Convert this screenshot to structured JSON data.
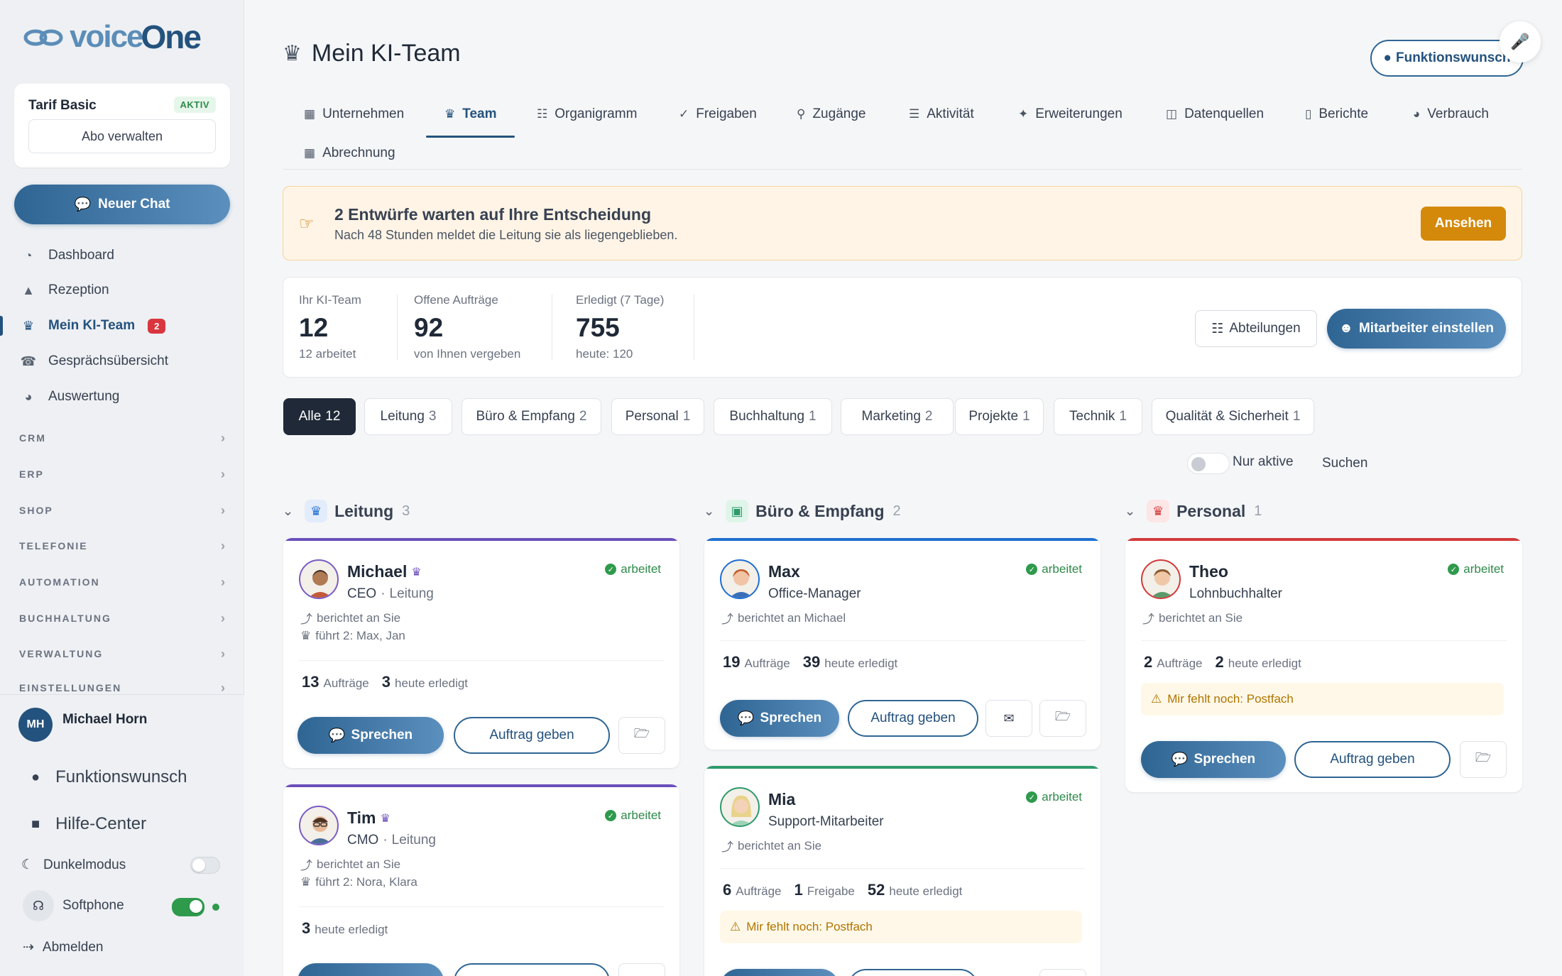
{
  "brand": {
    "logo_part1": "voice",
    "logo_part2": "One"
  },
  "sidebar": {
    "tarif": {
      "name": "Tarif Basic",
      "badge": "AKTIV",
      "manage": "Abo verwalten"
    },
    "new_chat": "Neuer Chat",
    "items": [
      {
        "label": "Dashboard",
        "icon": "dashboard-icon"
      },
      {
        "label": "Rezeption",
        "icon": "reception-bell-icon"
      },
      {
        "label": "Mein KI-Team",
        "icon": "team-icon",
        "badge": "2",
        "active": true
      },
      {
        "label": "Gesprächsübersicht",
        "icon": "phone-icon"
      },
      {
        "label": "Auswertung",
        "icon": "pie-chart-icon"
      }
    ],
    "sections": [
      "CRM",
      "ERP",
      "SHOP",
      "TELEFONIE",
      "AUTOMATION",
      "BUCHHALTUNG",
      "VERWALTUNG",
      "EINSTELLUNGEN"
    ],
    "user": {
      "initials": "MH",
      "name": "Michael Horn"
    },
    "links": {
      "feature": "Funktionswunsch",
      "help": "Hilfe-Center",
      "dark": "Dunkelmodus",
      "softphone": "Softphone",
      "logout": "Abmelden"
    },
    "dark_mode_on": false,
    "softphone_on": true
  },
  "header": {
    "title": "Mein KI-Team",
    "feature_button": "Funktionswunsch"
  },
  "tabs": [
    "Unternehmen",
    "Team",
    "Organigramm",
    "Freigaben",
    "Zugänge",
    "Aktivität",
    "Erweiterungen",
    "Datenquellen",
    "Berichte",
    "Verbrauch",
    "Abrechnung"
  ],
  "active_tab": "Team",
  "banner": {
    "heading": "2 Entwürfe warten auf Ihre Entscheidung",
    "sub": "Nach 48 Stunden meldet die Leitung sie als liegengeblieben.",
    "button": "Ansehen"
  },
  "stats": [
    {
      "label": "Ihr KI-Team",
      "value": "12",
      "sub": "12 arbeitet"
    },
    {
      "label": "Offene Aufträge",
      "value": "92",
      "sub": "von Ihnen vergeben"
    },
    {
      "label": "Erledigt (7 Tage)",
      "value": "755",
      "sub": "heute: 120"
    }
  ],
  "stats_buttons": {
    "departments": "Abteilungen",
    "hire": "Mitarbeiter einstellen"
  },
  "filters": [
    {
      "label": "Alle",
      "count": "12"
    },
    {
      "label": "Leitung",
      "count": "3"
    },
    {
      "label": "Büro & Empfang",
      "count": "2"
    },
    {
      "label": "Personal",
      "count": "1"
    },
    {
      "label": "Buchhaltung",
      "count": "1"
    },
    {
      "label": "Marketing",
      "count": "2"
    },
    {
      "label": "Projekte",
      "count": "1"
    },
    {
      "label": "Technik",
      "count": "1"
    },
    {
      "label": "Qualität & Sicherheit",
      "count": "1"
    }
  ],
  "only_active": "Nur aktive",
  "search": "Suchen",
  "columns": [
    {
      "name": "Leitung",
      "count": "3",
      "color": "#6b4fbb"
    },
    {
      "name": "Büro & Empfang",
      "count": "2",
      "color": "#1f6fd1"
    },
    {
      "name": "Personal",
      "count": "1",
      "color": "#d23a3a"
    }
  ],
  "cards": {
    "michael": {
      "name": "Michael",
      "role": "CEO",
      "dept": "Leitung",
      "status": "arbeitet",
      "reports": "berichtet an Sie",
      "leads": "führt 2: Max, Jan",
      "orders": "13",
      "orders_label": "Aufträge",
      "done": "3",
      "done_label": "heute erledigt"
    },
    "tim": {
      "name": "Tim",
      "role": "CMO",
      "dept": "Leitung",
      "status": "arbeitet",
      "reports": "berichtet an Sie",
      "leads": "führt 2: Nora, Klara",
      "done": "3",
      "done_label": "heute erledigt"
    },
    "max": {
      "name": "Max",
      "role": "Office-Manager",
      "status": "arbeitet",
      "reports": "berichtet an Michael",
      "orders": "19",
      "orders_label": "Aufträge",
      "done": "39",
      "done_label": "heute erledigt"
    },
    "mia": {
      "name": "Mia",
      "role": "Support-Mitarbeiter",
      "status": "arbeitet",
      "reports": "berichtet an Sie",
      "orders": "6",
      "orders_label": "Aufträge",
      "approvals": "1",
      "approvals_label": "Freigabe",
      "done": "52",
      "done_label": "heute erledigt",
      "warning": "Mir fehlt noch: Postfach"
    },
    "theo": {
      "name": "Theo",
      "role": "Lohnbuchhalter",
      "status": "arbeitet",
      "reports": "berichtet an Sie",
      "orders": "2",
      "orders_label": "Aufträge",
      "done": "2",
      "done_label": "heute erledigt",
      "warning": "Mir fehlt noch: Postfach"
    }
  },
  "actions": {
    "speak": "Sprechen",
    "assign": "Auftrag geben"
  },
  "separator": "·"
}
